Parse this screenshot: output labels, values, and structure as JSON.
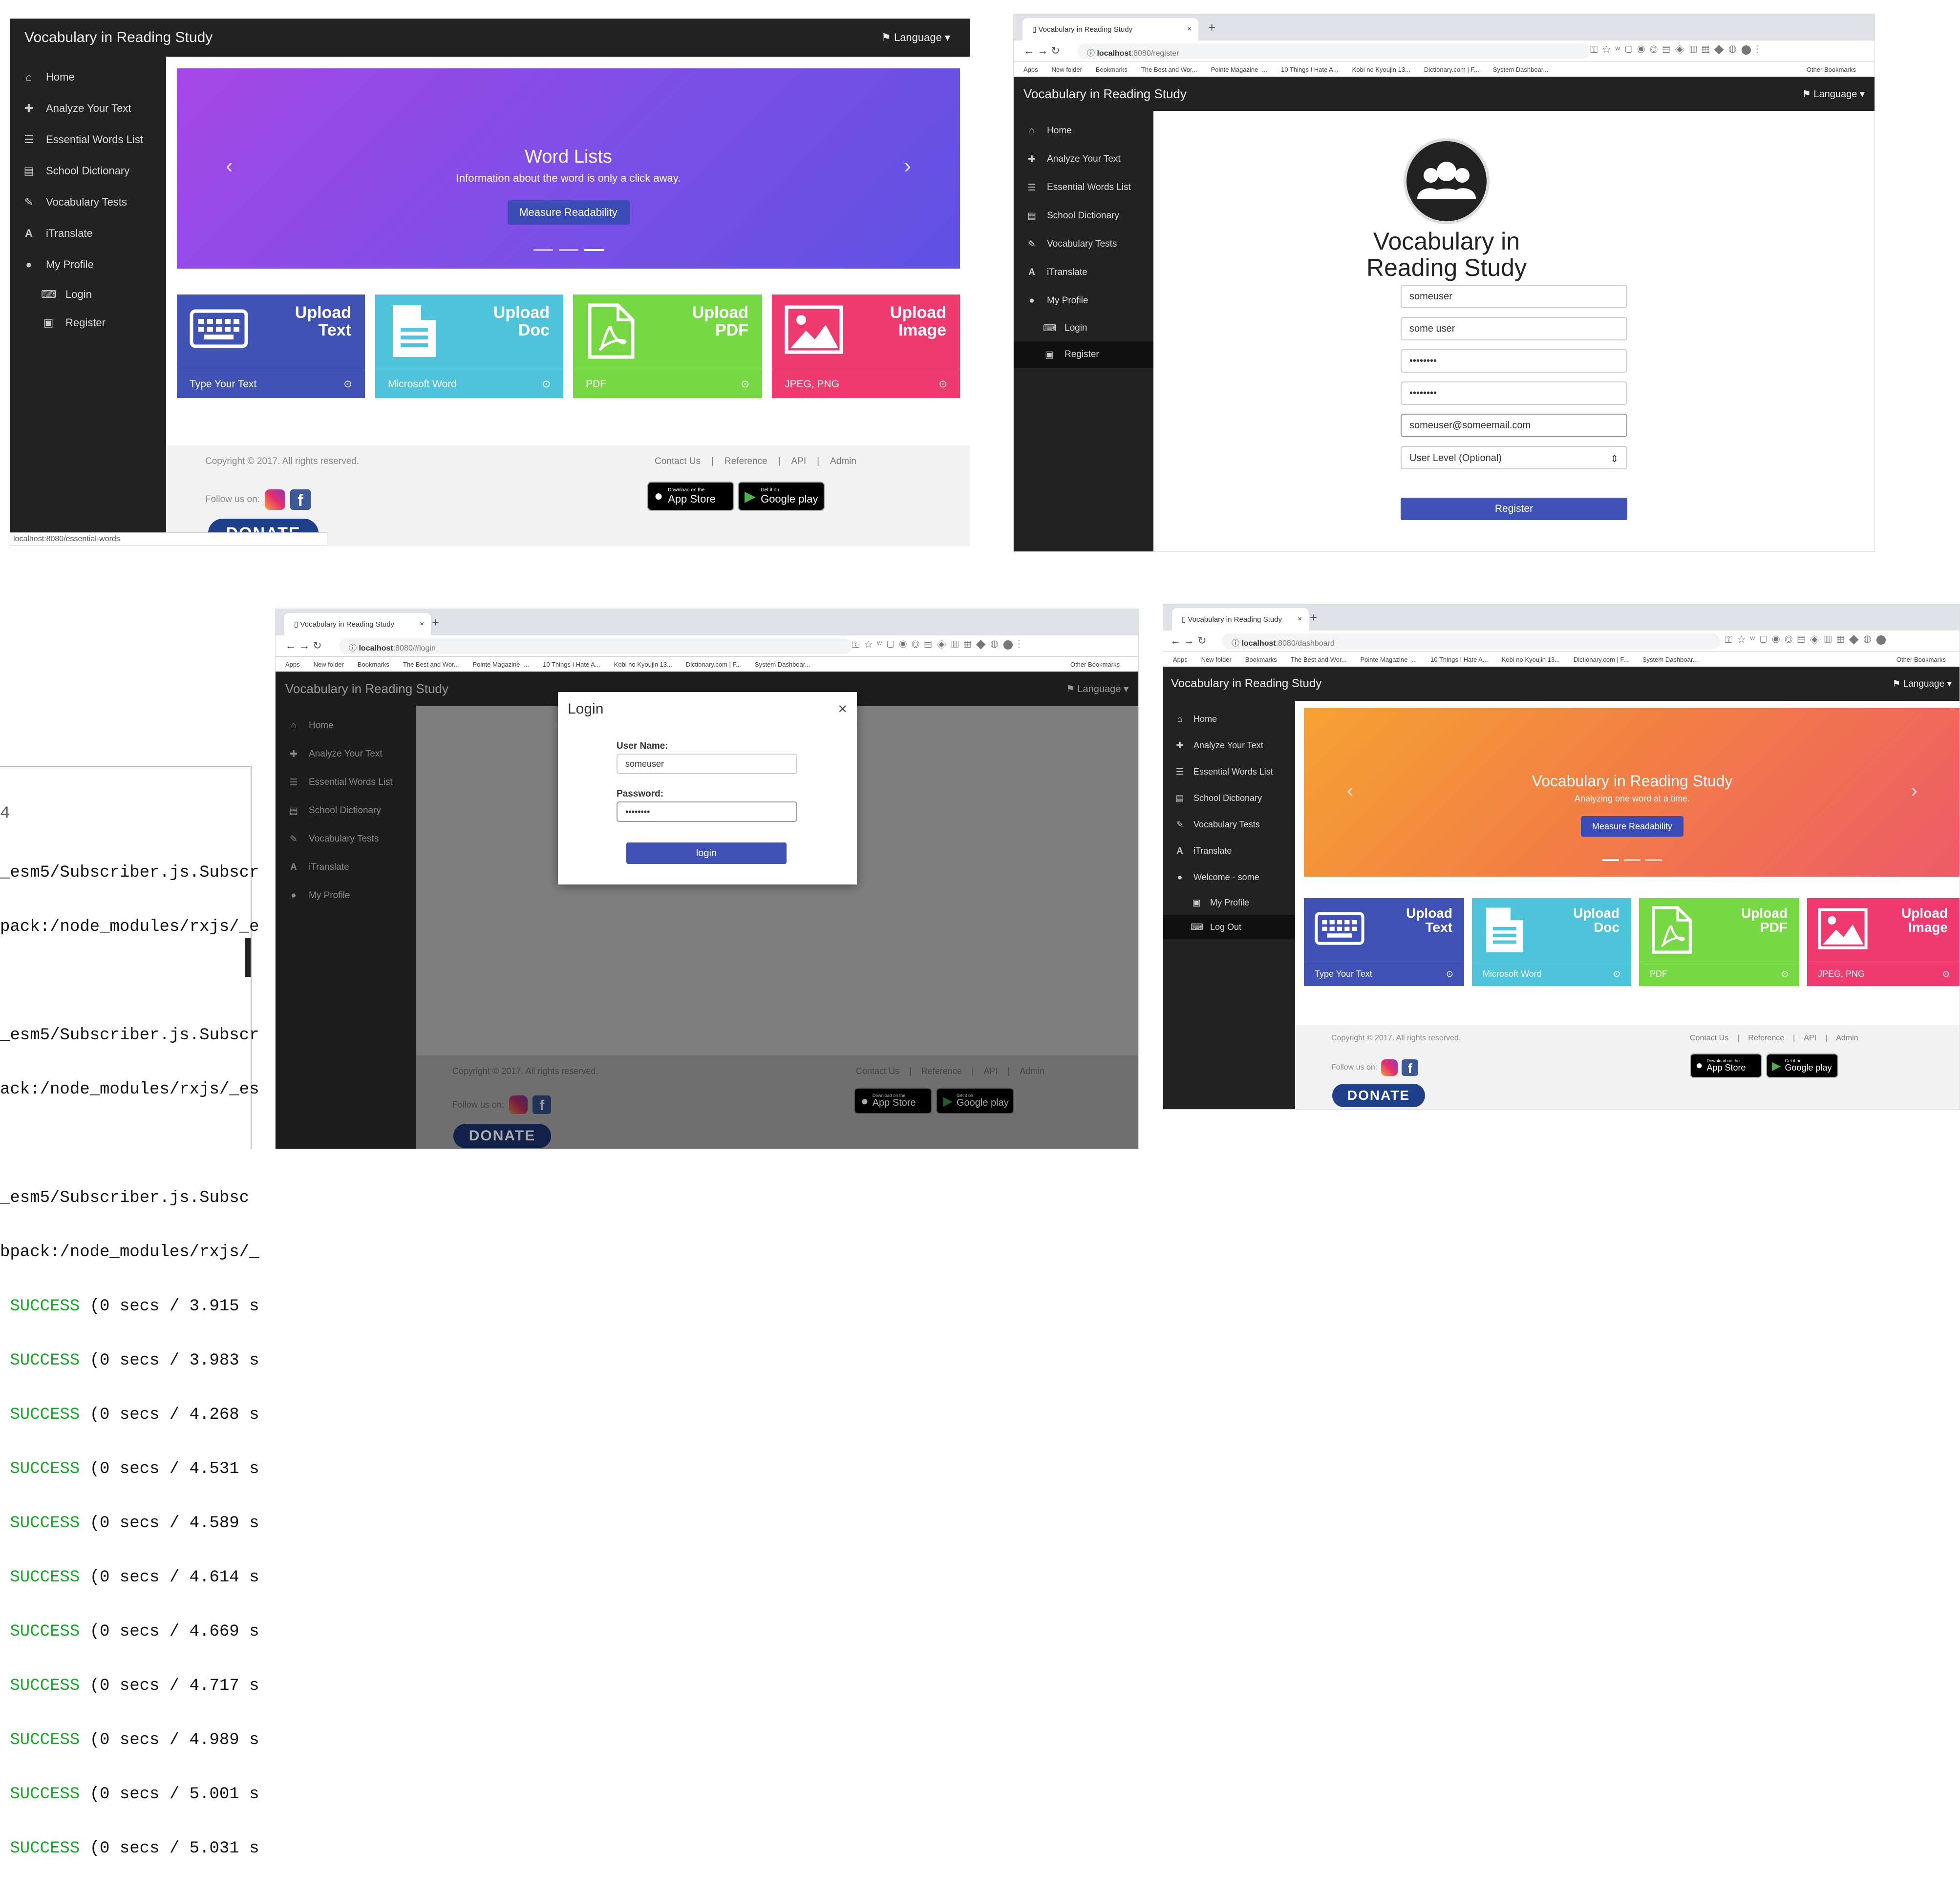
{
  "app": {
    "title": "Vocabulary in Reading Study",
    "language": "Language"
  },
  "menu": {
    "home": "Home",
    "analyze": "Analyze Your Text",
    "essential": "Essential Words List",
    "dictionary": "School Dictionary",
    "tests": "Vocabulary Tests",
    "itranslate": "iTranslate",
    "profile": "My Profile",
    "login": "Login",
    "register": "Register",
    "welcome": "Welcome - some",
    "logout": "Log Out"
  },
  "carousel1": {
    "title": "Word Lists",
    "subtitle": "Information about the word is only a click away.",
    "button": "Measure Readability"
  },
  "carousel2": {
    "title": "Vocabulary in Reading Study",
    "subtitle": "Analyzing one word at a time.",
    "button": "Measure Readability"
  },
  "cards": [
    {
      "line1": "Upload",
      "line2": "Text",
      "foot": "Type Your Text",
      "color": "#3f51b5"
    },
    {
      "line1": "Upload",
      "line2": "Doc",
      "foot": "Microsoft Word",
      "color": "#4fc3d9"
    },
    {
      "line1": "Upload",
      "line2": "PDF",
      "foot": "PDF",
      "color": "#76d843"
    },
    {
      "line1": "Upload",
      "line2": "Image",
      "foot": "JPEG, PNG",
      "color": "#ee3a6e"
    }
  ],
  "footer": {
    "copyright": "Copyright © 2017. All rights reserved.",
    "follow": "Follow us on:",
    "contact": "Contact Us",
    "reference": "Reference",
    "api": "API",
    "admin": "Admin",
    "appstore_small": "Download on the",
    "appstore": "App Store",
    "google_small": "Get it on",
    "google": "Google play",
    "donate": "DONATE",
    "sep": "|"
  },
  "statusbar": "localhost:8080/essential-words",
  "browser": {
    "tab_title": "Vocabulary in Reading Study",
    "url_register_host": "localhost",
    "url_register_path": ":8080/register",
    "url_login_host": "localhost",
    "url_login_path": ":8080/#login",
    "url_dash_host": "localhost",
    "url_dash_path": ":8080/dashboard",
    "bookmarks": [
      "Apps",
      "New folder",
      "Bookmarks",
      "The Best and Wor...",
      "Pointe Magazine -...",
      "10 Things I Hate A...",
      "Kobi no Kyoujin 13...",
      "Dictionary.com | F...",
      "System Dashboar..."
    ],
    "other": "Other Bookmarks"
  },
  "register": {
    "title_line1": "Vocabulary in",
    "title_line2": "Reading Study",
    "username": "someuser",
    "name": "some user",
    "password": "••••••••",
    "confirm": "••••••••",
    "email": "someuser@someemail.com",
    "level": "User Level (Optional)",
    "button": "Register"
  },
  "login": {
    "title": "Login",
    "close": "×",
    "user_label": "User Name:",
    "user_value": "someuser",
    "pass_label": "Password:",
    "pass_value": "••••••••",
    "button": "login"
  },
  "terminal": {
    "header": "4",
    "lines": [
      "_esm5/Subscriber.js.Subscr",
      "pack:/node_modules/rxjs/_e",
      "",
      "_esm5/Subscriber.js.Subscr",
      "ack:/node_modules/rxjs/_es",
      "",
      "_esm5/Subscriber.js.Subsc",
      "bpack:/node_modules/rxjs/_"
    ],
    "success": [
      {
        "word": "SUCCESS",
        "rest": " (0 secs / 3.915 s"
      },
      {
        "word": "SUCCESS",
        "rest": " (0 secs / 3.983 s"
      },
      {
        "word": "SUCCESS",
        "rest": " (0 secs / 4.268 s"
      },
      {
        "word": "SUCCESS",
        "rest": " (0 secs / 4.531 s"
      },
      {
        "word": "SUCCESS",
        "rest": " (0 secs / 4.589 s"
      },
      {
        "word": "SUCCESS",
        "rest": " (0 secs / 4.614 s"
      },
      {
        "word": "SUCCESS",
        "rest": " (0 secs / 4.669 s"
      },
      {
        "word": "SUCCESS",
        "rest": " (0 secs / 4.717 s"
      },
      {
        "word": "SUCCESS",
        "rest": " (0 secs / 4.989 s"
      },
      {
        "word": "SUCCESS",
        "rest": " (0 secs / 5.001 s"
      },
      {
        "word": "SUCCESS",
        "rest": " (0 secs / 5.031 s"
      }
    ]
  }
}
